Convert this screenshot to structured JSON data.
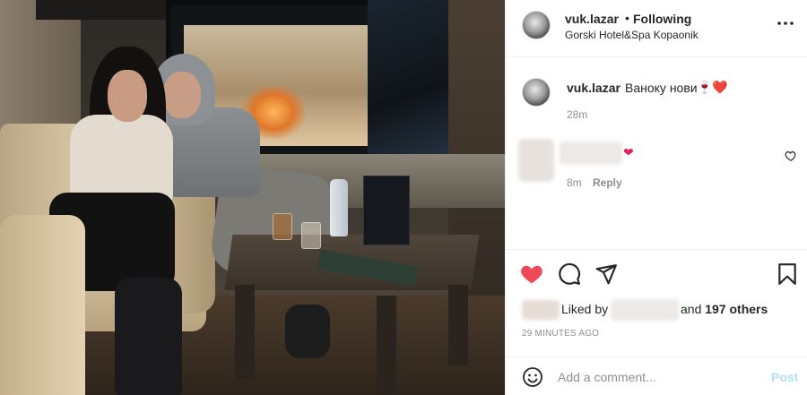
{
  "header": {
    "username": "vuk.lazar",
    "separator": "•",
    "follow_status": "Following",
    "location": "Gorski Hotel&Spa Kopaonik",
    "more_icon": "more-horizontal-icon"
  },
  "caption": {
    "username": "vuk.lazar",
    "text": "Ваноку нови",
    "emoji": "🍷❤️",
    "time": "28m"
  },
  "comment": {
    "emoji": "❤",
    "time": "8m",
    "reply_label": "Reply"
  },
  "actions": {
    "like_icon": "heart-filled-icon",
    "comment_icon": "comment-icon",
    "share_icon": "send-icon",
    "save_icon": "bookmark-icon"
  },
  "likes": {
    "prefix": "Liked by",
    "and": "and",
    "others": "197 others"
  },
  "post_time": "29 MINUTES AGO",
  "add_comment": {
    "placeholder": "Add a comment...",
    "post_label": "Post"
  },
  "colors": {
    "like_red": "#ed4956",
    "post_disabled_blue": "#b2dffc",
    "secondary_text": "#8e8e8e"
  }
}
